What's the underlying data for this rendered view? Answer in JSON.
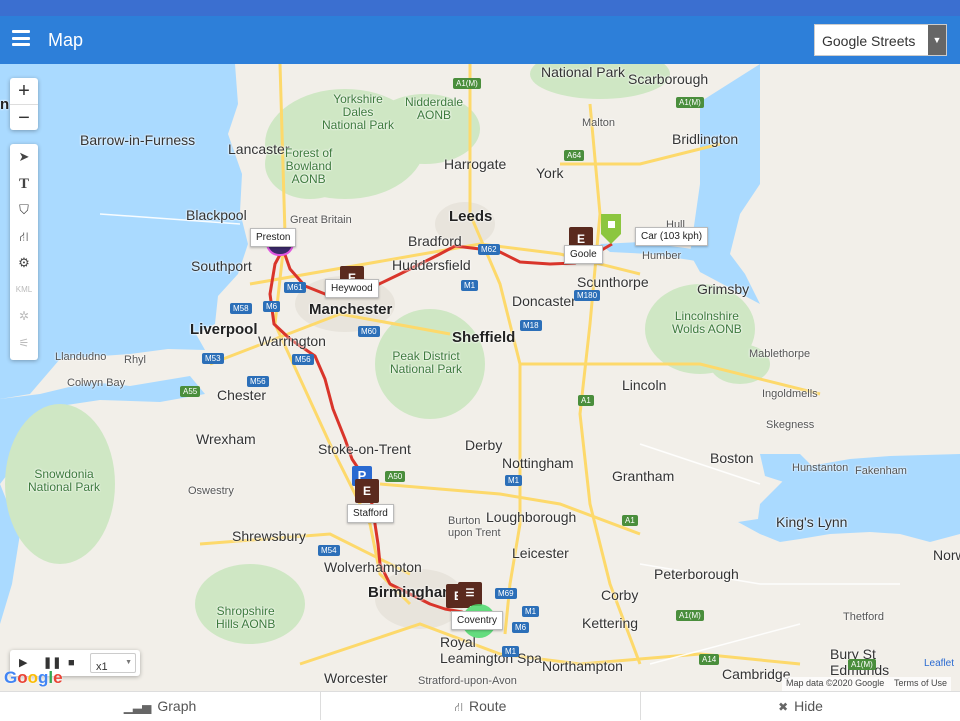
{
  "header": {
    "title": "Map",
    "layer_select": "Google Streets",
    "accent_color": "#2d7fd9"
  },
  "map": {
    "cities": [
      {
        "label": "National Park",
        "style": "normal"
      },
      {
        "label": "Scarborough",
        "style": "normal"
      },
      {
        "label": "Yorkshire\nDales\nNational Park",
        "style": "green"
      },
      {
        "label": "Nidderdale\nAONB",
        "style": "green"
      },
      {
        "label": "Malton",
        "style": "small"
      },
      {
        "label": "Bridlington",
        "style": "normal"
      },
      {
        "label": "Barrow-in-Furness",
        "style": "normal"
      },
      {
        "label": "Lancaster",
        "style": "normal"
      },
      {
        "label": "Forest of\nBowland\nAONB",
        "style": "green"
      },
      {
        "label": "Harrogate",
        "style": "normal"
      },
      {
        "label": "York",
        "style": "normal"
      },
      {
        "label": "Blackpool",
        "style": "normal"
      },
      {
        "label": "Great Britain",
        "style": "small"
      },
      {
        "label": "Leeds",
        "style": "big"
      },
      {
        "label": "Bradford",
        "style": "normal"
      },
      {
        "label": "Hull",
        "style": "small"
      },
      {
        "label": "Southport",
        "style": "normal"
      },
      {
        "label": "Huddersfield",
        "style": "normal"
      },
      {
        "label": "Scunthorpe",
        "style": "normal"
      },
      {
        "label": "Humber",
        "style": "small"
      },
      {
        "label": "Doncaster",
        "style": "normal"
      },
      {
        "label": "Grimsby",
        "style": "normal"
      },
      {
        "label": "Manchester",
        "style": "big"
      },
      {
        "label": "Liverpool",
        "style": "big"
      },
      {
        "label": "Warrington",
        "style": "normal"
      },
      {
        "label": "Sheffield",
        "style": "big"
      },
      {
        "label": "Lincolnshire\nWolds AONB",
        "style": "green"
      },
      {
        "label": "Llandudno",
        "style": "small"
      },
      {
        "label": "Rhyl",
        "style": "small"
      },
      {
        "label": "Peak District\nNational Park",
        "style": "green"
      },
      {
        "label": "Mablethorpe",
        "style": "small"
      },
      {
        "label": "Colwyn Bay",
        "style": "small"
      },
      {
        "label": "Chester",
        "style": "normal"
      },
      {
        "label": "Lincoln",
        "style": "normal"
      },
      {
        "label": "Ingoldmells",
        "style": "small"
      },
      {
        "label": "Skegness",
        "style": "small"
      },
      {
        "label": "Wrexham",
        "style": "normal"
      },
      {
        "label": "Stoke-on-Trent",
        "style": "normal"
      },
      {
        "label": "Nottingham",
        "style": "normal"
      },
      {
        "label": "Boston",
        "style": "normal"
      },
      {
        "label": "Snowdonia\nNational Park",
        "style": "green"
      },
      {
        "label": "Derby",
        "style": "normal"
      },
      {
        "label": "Grantham",
        "style": "normal"
      },
      {
        "label": "Hunstanton",
        "style": "small"
      },
      {
        "label": "Oswestry",
        "style": "small"
      },
      {
        "label": "Fakenham",
        "style": "small"
      },
      {
        "label": "Loughborough",
        "style": "normal"
      },
      {
        "label": "Burton\nupon Trent",
        "style": "small"
      },
      {
        "label": "King's Lynn",
        "style": "normal"
      },
      {
        "label": "Shrewsbury",
        "style": "normal"
      },
      {
        "label": "Leicester",
        "style": "normal"
      },
      {
        "label": "Norw",
        "style": "normal"
      },
      {
        "label": "Wolverhampton",
        "style": "normal"
      },
      {
        "label": "Peterborough",
        "style": "normal"
      },
      {
        "label": "Birmingham",
        "style": "big"
      },
      {
        "label": "Corby",
        "style": "normal"
      },
      {
        "label": "Shropshire\nHills AONB",
        "style": "green"
      },
      {
        "label": "Thetford",
        "style": "small"
      },
      {
        "label": "Kettering",
        "style": "normal"
      },
      {
        "label": "Royal\nLeamington Spa",
        "style": "normal"
      },
      {
        "label": "Bury St\nEdmunds",
        "style": "normal"
      },
      {
        "label": "Northampton",
        "style": "normal"
      },
      {
        "label": "Cambridge",
        "style": "normal"
      },
      {
        "label": "Worcester",
        "style": "normal"
      },
      {
        "label": "Stratford-upon-Avon",
        "style": "small"
      },
      {
        "label": "n",
        "style": "big"
      }
    ],
    "road_shields": [
      "A1(M)",
      "A64",
      "A1(M)",
      "M62",
      "M61",
      "M1",
      "M180",
      "M58",
      "M6",
      "M60",
      "M53",
      "M18",
      "M56",
      "M56",
      "A55",
      "A1",
      "A50",
      "M1",
      "A1",
      "M54",
      "M69",
      "M1",
      "M6",
      "M1",
      "A1(M)",
      "A14",
      "A1(M)"
    ],
    "route_color": "#d9352b",
    "markers": {
      "preston": {
        "label": "Preston",
        "badge": ""
      },
      "heywood": {
        "label": "Heywood",
        "badge": "E"
      },
      "goole": {
        "label": "Goole",
        "badge": "E"
      },
      "car": {
        "label": "Car (103 kph)"
      },
      "stafford": {
        "label": "Stafford",
        "badge_e": "E",
        "badge_p": "P"
      },
      "coventry": {
        "label": "Coventry",
        "badge": "E"
      }
    }
  },
  "controls": {
    "zoom_in": "+",
    "zoom_out": "−",
    "tools": [
      "locate-icon",
      "text-icon",
      "shield-icon",
      "road-icon",
      "gear-icon",
      "kml-icon",
      "poi-icon",
      "traffic-icon"
    ],
    "tool_kml_label": "KML",
    "playback": {
      "speed": "x1"
    }
  },
  "footer": {
    "google_logo": "Google",
    "leaflet": "Leaflet",
    "attribution": "Map data ©2020 Google",
    "terms": "Terms of Use"
  },
  "bottom_tabs": [
    {
      "label": "Graph",
      "icon": "bar-chart-icon"
    },
    {
      "label": "Route",
      "icon": "road-icon"
    },
    {
      "label": "Hide",
      "icon": "close-icon"
    }
  ]
}
